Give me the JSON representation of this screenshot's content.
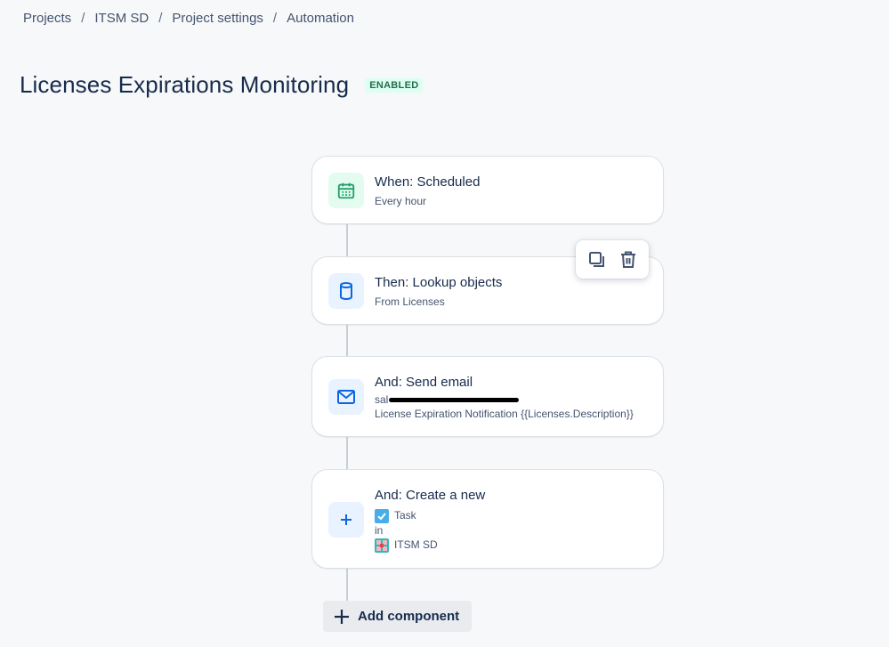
{
  "breadcrumb": {
    "items": [
      "Projects",
      "ITSM SD",
      "Project settings",
      "Automation"
    ],
    "separator": "/"
  },
  "rule": {
    "title": "Licenses Expirations Monitoring",
    "status": "ENABLED"
  },
  "components": {
    "trigger": {
      "heading": "When: Scheduled",
      "sub": "Every hour",
      "icon": "calendar-icon"
    },
    "lookup": {
      "heading": "Then: Lookup objects",
      "sub": "From Licenses",
      "icon": "database-icon"
    },
    "email": {
      "heading": "And: Send email",
      "recipient_prefix": "sal",
      "subject": "License Expiration Notification {{Licenses.Description}}",
      "icon": "mail-icon"
    },
    "create": {
      "heading": "And: Create a new",
      "issue_type": "Task",
      "in_label": "in",
      "project": "ITSM SD",
      "icon": "plus-icon"
    }
  },
  "toolbar": {
    "duplicate_icon": "copy-icon",
    "delete_icon": "trash-icon"
  },
  "add_component": {
    "label": "Add component"
  },
  "colors": {
    "accent": "#0c66e4",
    "green": "#22a06b",
    "badge_bg": "#dcfff1",
    "badge_text": "#216e4e"
  }
}
